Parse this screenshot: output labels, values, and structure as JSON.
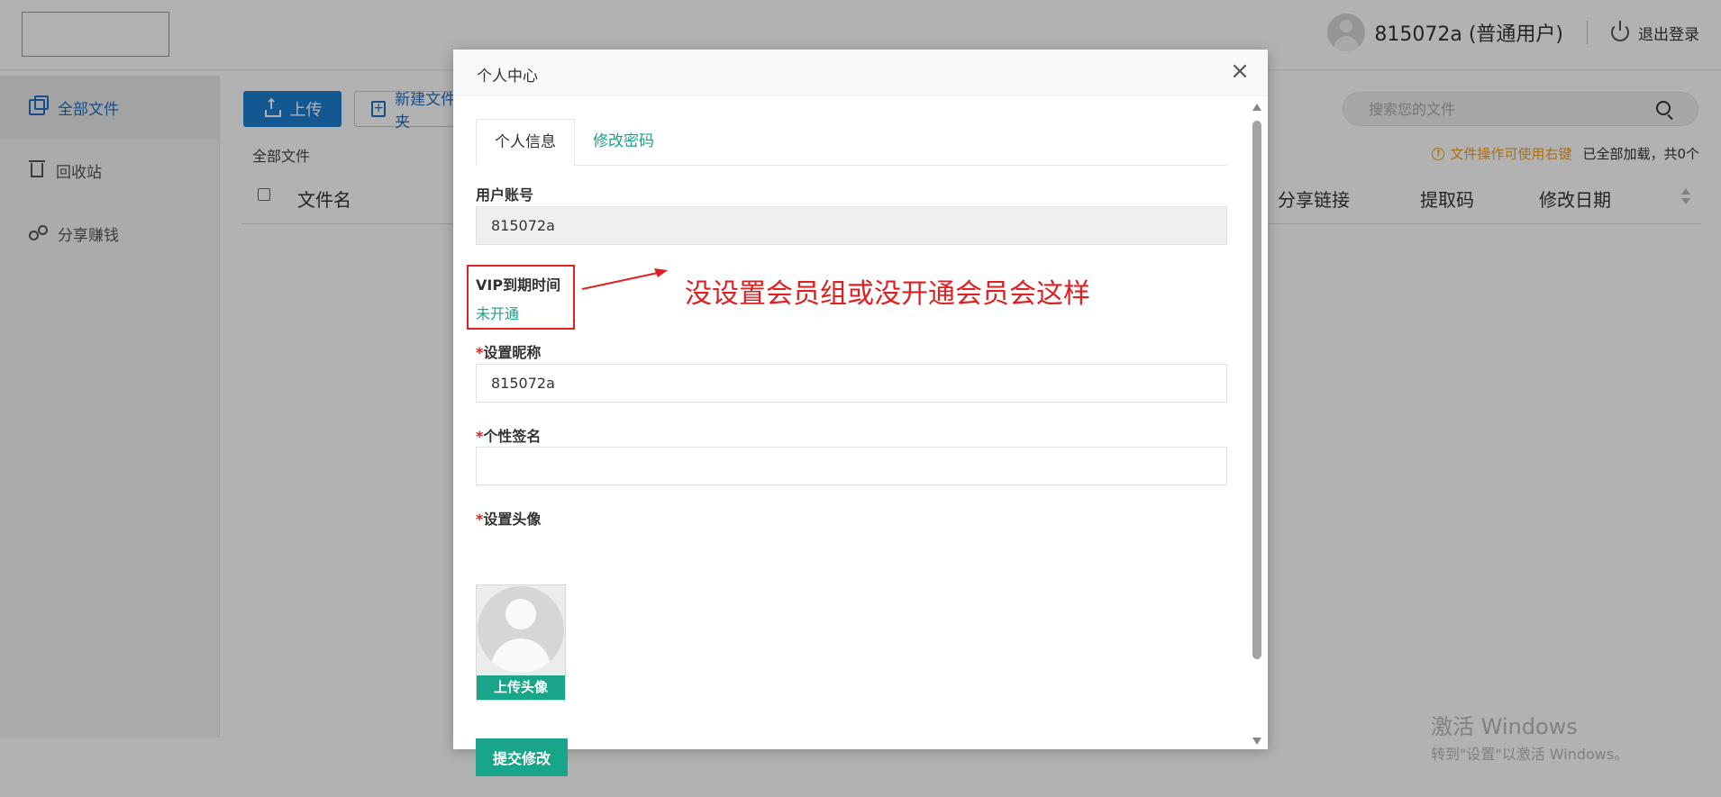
{
  "header": {
    "username": "815072a (普通用户)",
    "logout_label": "退出登录"
  },
  "sidebar": {
    "items": [
      {
        "label": "全部文件",
        "icon": "files-icon",
        "active": true
      },
      {
        "label": "回收站",
        "icon": "trash-icon",
        "active": false
      },
      {
        "label": "分享赚钱",
        "icon": "share-icon",
        "active": false
      }
    ]
  },
  "toolbar": {
    "upload_label": "上传",
    "new_folder_label": "新建文件夹"
  },
  "breadcrumb": "全部文件",
  "search": {
    "placeholder": "搜索您的文件"
  },
  "hint": {
    "warning": "文件操作可使用右键",
    "count": "已全部加载，共0个"
  },
  "table": {
    "columns": [
      "文件名",
      "分享链接",
      "提取码",
      "修改日期"
    ]
  },
  "watermark": {
    "line1": "激活 Windows",
    "line2": "转到\"设置\"以激活 Windows。"
  },
  "modal": {
    "title": "个人中心",
    "close": "×",
    "tabs": [
      "个人信息",
      "修改密码"
    ],
    "account_label": "用户账号",
    "account_value": "815072a",
    "vip_label": "VIP到期时间",
    "vip_value": "未开通",
    "nickname_label": "设置昵称",
    "nickname_value": "815072a",
    "signature_label": "个性签名",
    "signature_value": "",
    "avatar_label": "设置头像",
    "avatar_button": "上传头像",
    "submit_label": "提交修改",
    "required_mark": "*"
  },
  "annotation": {
    "text": "没设置会员组或没开通会员会这样"
  },
  "colors": {
    "accent_blue": "#1e7fd1",
    "accent_green": "#18a58a",
    "annotation_red": "#e02020",
    "warning_orange": "#f0a020"
  }
}
